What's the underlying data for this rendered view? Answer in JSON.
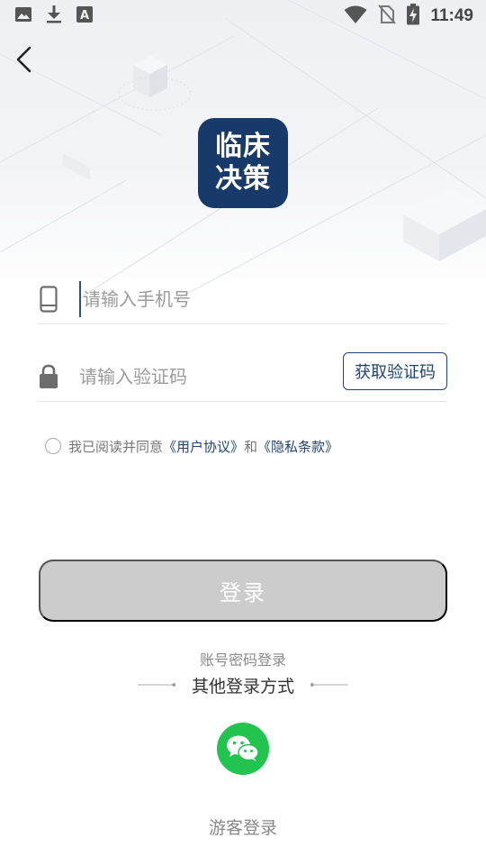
{
  "status_bar": {
    "time": "11:49",
    "left_icons": [
      "image-icon",
      "download-icon",
      "font-icon"
    ],
    "right_icons": [
      "wifi-icon",
      "no-sim-icon",
      "battery-charging-icon"
    ]
  },
  "header": {
    "back_icon": "back-arrow-icon"
  },
  "logo": {
    "line1": "临床",
    "line2": "决策",
    "background": "#173a6a"
  },
  "form": {
    "phone": {
      "placeholder": "请输入手机号",
      "value": "",
      "icon": "mobile-phone-icon"
    },
    "code": {
      "placeholder": "请输入验证码",
      "value": "",
      "icon": "lock-icon"
    },
    "get_code_label": "获取验证码"
  },
  "agreement": {
    "checked": false,
    "prefix": "我已阅读并同意",
    "user_agreement": "《用户协议》",
    "conjunction": "和",
    "privacy_policy": "《隐私条款》"
  },
  "login_button": {
    "label": "登录",
    "enabled": false,
    "color": "#cccccc"
  },
  "alt_login": {
    "password_login": "账号密码登录",
    "other_title": "其他登录方式",
    "wechat_icon": "wechat-icon",
    "wechat_color": "#22c34f",
    "guest_login": "游客登录"
  },
  "colors": {
    "accent": "#1f4474"
  }
}
